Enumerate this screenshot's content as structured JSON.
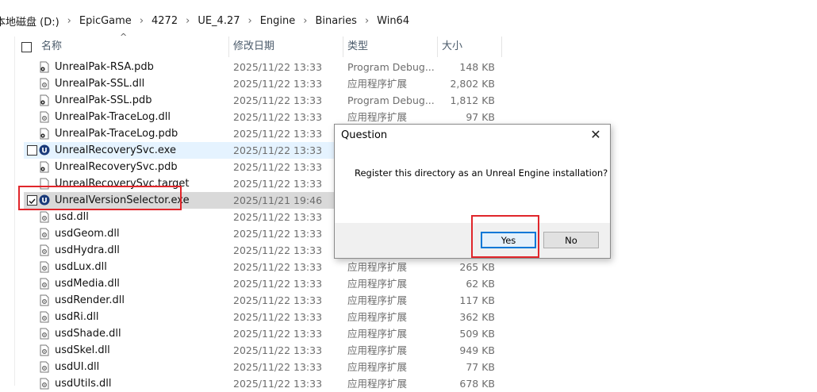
{
  "breadcrumb": [
    "本地磁盘 (D:)",
    "EpicGame",
    "4272",
    "UE_4.27",
    "Engine",
    "Binaries",
    "Win64"
  ],
  "columns": {
    "name": "名称",
    "date": "修改日期",
    "type": "类型",
    "size": "大小"
  },
  "files": [
    {
      "name": "UnrealPak-RSA.pdb",
      "date": "2025/11/22 13:33",
      "type": "Program Debug...",
      "size": "148 KB",
      "icon": "pdb-file-icon"
    },
    {
      "name": "UnrealPak-SSL.dll",
      "date": "2025/11/22 13:33",
      "type": "应用程序扩展",
      "size": "2,802 KB",
      "icon": "dll-file-icon"
    },
    {
      "name": "UnrealPak-SSL.pdb",
      "date": "2025/11/22 13:33",
      "type": "Program Debug...",
      "size": "1,812 KB",
      "icon": "pdb-file-icon"
    },
    {
      "name": "UnrealPak-TraceLog.dll",
      "date": "2025/11/22 13:33",
      "type": "应用程序扩展",
      "size": "97 KB",
      "icon": "dll-file-icon"
    },
    {
      "name": "UnrealPak-TraceLog.pdb",
      "date": "2025/11/22 13:33",
      "type": "",
      "size": "",
      "icon": "pdb-file-icon"
    },
    {
      "name": "UnrealRecoverySvc.exe",
      "date": "2025/11/22 13:33",
      "type": "",
      "size": "",
      "icon": "unreal-exe-icon"
    },
    {
      "name": "UnrealRecoverySvc.pdb",
      "date": "2025/11/22 13:33",
      "type": "",
      "size": "",
      "icon": "pdb-file-icon"
    },
    {
      "name": "UnrealRecoverySvc.target",
      "date": "2025/11/22 13:33",
      "type": "",
      "size": "",
      "icon": "generic-file-icon"
    },
    {
      "name": "UnrealVersionSelector.exe",
      "date": "2025/11/21 19:46",
      "type": "",
      "size": "",
      "icon": "unreal-exe-icon"
    },
    {
      "name": "usd.dll",
      "date": "2025/11/22 13:33",
      "type": "",
      "size": "",
      "icon": "dll-file-icon"
    },
    {
      "name": "usdGeom.dll",
      "date": "2025/11/22 13:33",
      "type": "",
      "size": "",
      "icon": "dll-file-icon"
    },
    {
      "name": "usdHydra.dll",
      "date": "2025/11/22 13:33",
      "type": "",
      "size": "",
      "icon": "dll-file-icon"
    },
    {
      "name": "usdLux.dll",
      "date": "2025/11/22 13:33",
      "type": "应用程序扩展",
      "size": "265 KB",
      "icon": "dll-file-icon"
    },
    {
      "name": "usdMedia.dll",
      "date": "2025/11/22 13:33",
      "type": "应用程序扩展",
      "size": "62 KB",
      "icon": "dll-file-icon"
    },
    {
      "name": "usdRender.dll",
      "date": "2025/11/22 13:33",
      "type": "应用程序扩展",
      "size": "117 KB",
      "icon": "dll-file-icon"
    },
    {
      "name": "usdRi.dll",
      "date": "2025/11/22 13:33",
      "type": "应用程序扩展",
      "size": "362 KB",
      "icon": "dll-file-icon"
    },
    {
      "name": "usdShade.dll",
      "date": "2025/11/22 13:33",
      "type": "应用程序扩展",
      "size": "509 KB",
      "icon": "dll-file-icon"
    },
    {
      "name": "usdSkel.dll",
      "date": "2025/11/22 13:33",
      "type": "应用程序扩展",
      "size": "949 KB",
      "icon": "dll-file-icon"
    },
    {
      "name": "usdUI.dll",
      "date": "2025/11/22 13:33",
      "type": "应用程序扩展",
      "size": "77 KB",
      "icon": "dll-file-icon"
    },
    {
      "name": "usdUtils.dll",
      "date": "2025/11/22 13:33",
      "type": "应用程序扩展",
      "size": "678 KB",
      "icon": "dll-file-icon"
    }
  ],
  "hovered_file": "UnrealRecoverySvc.exe",
  "selected_file": "UnrealVersionSelector.exe",
  "dialog": {
    "title": "Question",
    "message": "Register this directory as an Unreal Engine installation?",
    "yes_label": "Yes",
    "no_label": "No",
    "close_glyph": "✕"
  },
  "colors": {
    "highlight_box": "#e0262b",
    "selection": "#d9d9d9",
    "hover": "#e5f3ff",
    "default_button_border": "#0078d7"
  }
}
